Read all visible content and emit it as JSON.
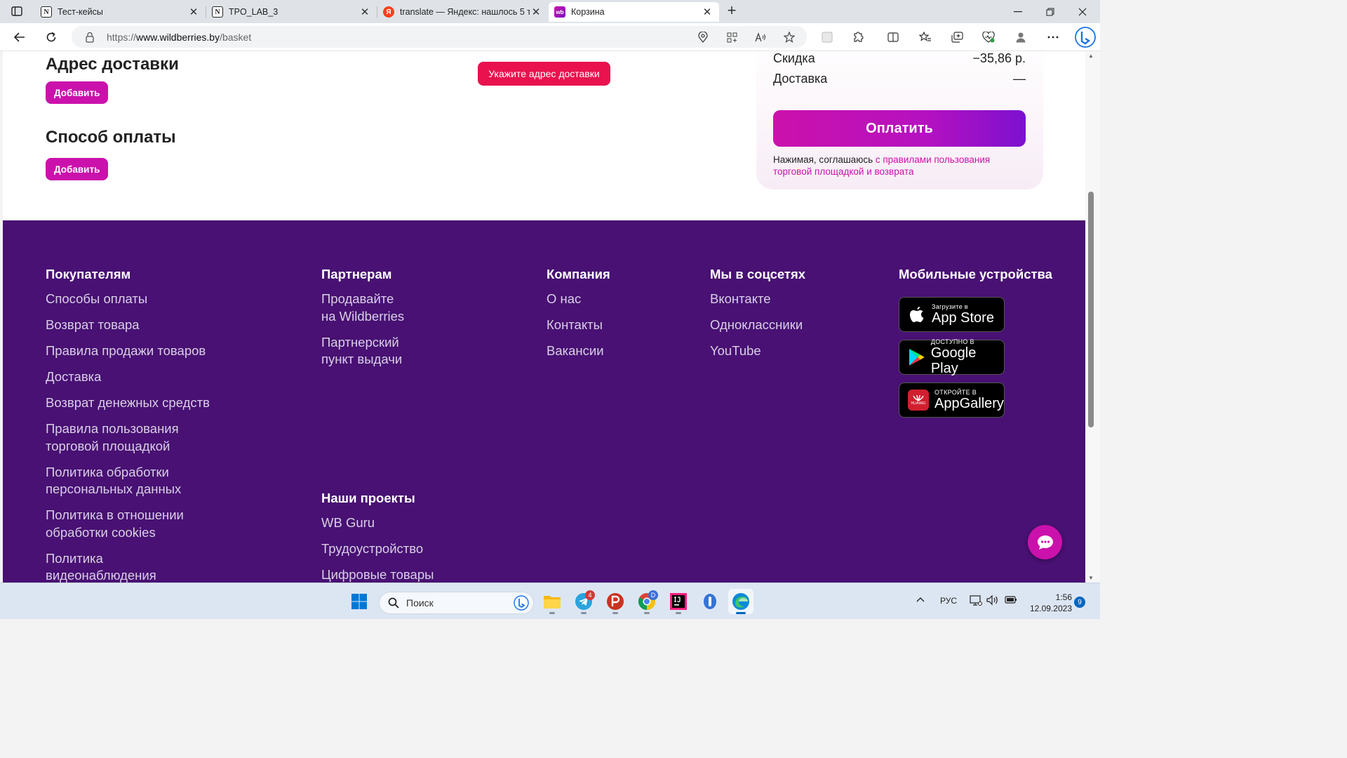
{
  "browser": {
    "tabs": [
      {
        "title": "Тест-кейсы",
        "favicon": "notion-icon"
      },
      {
        "title": "TPO_LAB_3",
        "favicon": "notion-icon"
      },
      {
        "title": "translate — Яндекс: нашлось 5 т",
        "favicon": "yandex-icon"
      },
      {
        "title": "Корзина",
        "favicon": "wildberries-icon",
        "active": true
      }
    ],
    "url_prefix": "https://",
    "url_host": "www.wildberries.by",
    "url_path": "/basket",
    "favicon_wb_text": "wb",
    "favicon_ya_text": "Я",
    "favicon_notion_text": "N"
  },
  "checkout": {
    "address_title": "Адрес доставки",
    "address_add": "Добавить",
    "address_warning": "Укажите адрес доставки",
    "payment_title": "Способ оплаты",
    "payment_add": "Добавить"
  },
  "summary": {
    "discount_label": "Скидка",
    "discount_value": "−35,86 р.",
    "delivery_label": "Доставка",
    "delivery_value": "—",
    "pay_button": "Оплатить",
    "consent_text": "Нажимая, соглашаюсь ",
    "consent_link": "с правилами пользования торговой площадкой и возврата"
  },
  "footer": {
    "buyers": {
      "title": "Покупателям",
      "links": [
        "Способы оплаты",
        "Возврат товара",
        "Правила продажи товаров",
        "Доставка",
        "Возврат денежных средств",
        "Правила пользования\nторговой площадкой",
        "Политика обработки\nперсональных данных",
        "Политика в отношении\nобработки cookies",
        "Политика\nвидеонаблюдения"
      ]
    },
    "partners": {
      "title": "Партнерам",
      "links": [
        "Продавайте\nна Wildberries",
        "Партнерский\nпункт выдачи"
      ]
    },
    "projects": {
      "title": "Наши проекты",
      "links": [
        "WB Guru",
        "Трудоустройство",
        "Цифровые товары"
      ]
    },
    "company": {
      "title": "Компания",
      "links": [
        "О нас",
        "Контакты",
        "Вакансии"
      ]
    },
    "social": {
      "title": "Мы в соцсетях",
      "links": [
        "Вконтакте",
        "Одноклассники",
        "YouTube"
      ]
    },
    "mobile": {
      "title": "Мобильные устройства",
      "appstore_top": "Загрузите в",
      "appstore_main": "App Store",
      "googleplay_top": "ДОСТУПНО В",
      "googleplay_main": "Google Play",
      "appgallery_top": "ОТКРОЙТЕ В",
      "appgallery_main": "AppGallery",
      "huawei_label": "HUAWEI"
    }
  },
  "taskbar": {
    "search_label": "Поиск",
    "telegram_badge": "4",
    "chrome_badge": "D",
    "language": "РУС",
    "time": "1:56",
    "date": "12.09.2023",
    "notifications": "9"
  },
  "colors": {
    "brand": "#cb11ab",
    "footer_bg": "#481173",
    "warning": "#e9124f"
  }
}
